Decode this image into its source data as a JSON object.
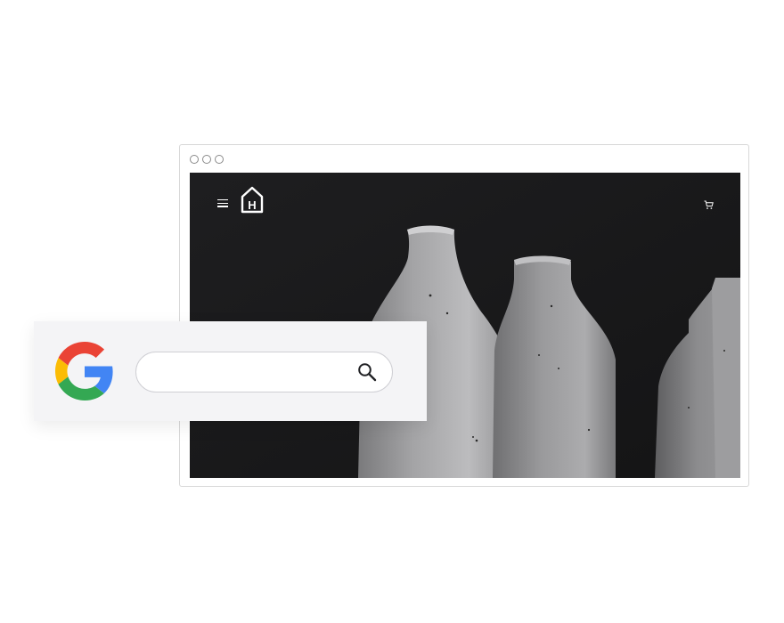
{
  "browser": {
    "window_controls": [
      "close",
      "minimize",
      "maximize"
    ]
  },
  "site": {
    "logo_letter": "H",
    "menu_icon": "hamburger-icon",
    "cart_icon": "cart-icon",
    "hero_image": "grey-ceramic-bottles"
  },
  "google": {
    "logo": "google-g-logo",
    "search": {
      "value": "",
      "placeholder": ""
    },
    "search_icon": "magnifier-icon",
    "colors": {
      "blue": "#4285F4",
      "red": "#EA4335",
      "yellow": "#FBBC05",
      "green": "#34A853"
    }
  }
}
